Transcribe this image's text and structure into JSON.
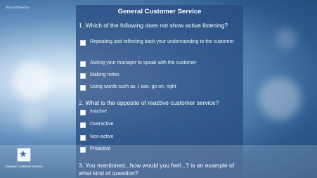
{
  "app": {
    "logo_text": "SmartMedia"
  },
  "header": {
    "title": "General Customer Service"
  },
  "questions": [
    {
      "text": "1. Which of the following does not show active listening?",
      "options": [
        "Repeating and reflecting back your understanding to the customer",
        "Asking your manager to speak with the customer",
        "Making notes",
        "Using words such as, I see, go on, right"
      ]
    },
    {
      "text": "2. What is the opposite of reactive customer service?",
      "options": [
        "Inactive",
        "Overactive",
        "Non-active",
        "Proactive"
      ]
    },
    {
      "text": "3. You mentioned...how would you feel...? is an example of what kind of question?",
      "options": []
    }
  ],
  "bottom_tile": {
    "label": "General Customer Service",
    "icon": "star-icon"
  }
}
